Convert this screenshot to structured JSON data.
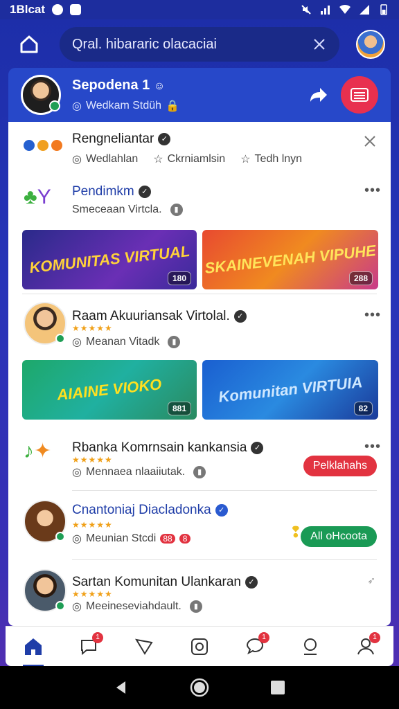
{
  "status_bar": {
    "time": "1Blcat",
    "right_icons": [
      "mute-icon",
      "wifi-icon",
      "signal-icon",
      "battery-icon"
    ]
  },
  "header": {
    "search_text": "Qral. hibararic olacaciai",
    "clear_icon": "close-icon"
  },
  "profile": {
    "name": "Sepodena 1",
    "sub": "Wedkam Stdüh",
    "share_icon": "share-icon",
    "menu_icon": "menu-icon"
  },
  "feed": {
    "item1": {
      "title": "Rengneliantar",
      "actions": [
        "Wedlahlan",
        "Ckrniamlsin",
        "Tedh lnyn"
      ]
    },
    "item2": {
      "title": "Pendimkm",
      "meta": "Smeceaan Virtcla.",
      "banners": [
        {
          "text": "KOMUNITAS VIRTUAL",
          "count": "180"
        },
        {
          "text": "SKAINEVENAH VIPUHE",
          "count": "288"
        }
      ]
    },
    "item3": {
      "title": "Raam Akuuriansak Virtolal.",
      "meta": "Meanan Vitadk",
      "banners": [
        {
          "text": "AIAINE VIOKO",
          "count": "881"
        },
        {
          "text": "Komunitan VIRTUIA",
          "count": "82"
        }
      ]
    },
    "item4": {
      "title": "Rbanka Komrnsain kankansia",
      "meta": "Mennaea nlaaiiutak.",
      "button": "Pelklahahs"
    },
    "item5": {
      "title": "Cnantoniaj Diacladonka",
      "meta": "Meunian Stcdi",
      "meta_badges": [
        "88",
        "8"
      ],
      "button": "All oHcoota"
    },
    "item6": {
      "title": "Sartan Komunitan Ulankaran",
      "meta": "Meeineseviahdault."
    }
  },
  "bottom_nav": [
    {
      "name": "home",
      "icon": "home-icon",
      "badge": ""
    },
    {
      "name": "chat",
      "icon": "chat-icon",
      "badge": "1"
    },
    {
      "name": "explore",
      "icon": "send-icon",
      "badge": ""
    },
    {
      "name": "instagram",
      "icon": "camera-icon",
      "badge": ""
    },
    {
      "name": "messages",
      "icon": "message-icon",
      "badge": "1"
    },
    {
      "name": "community",
      "icon": "community-icon",
      "badge": ""
    },
    {
      "name": "profile",
      "icon": "profile-icon",
      "badge": "1"
    }
  ],
  "colors": {
    "accent": "#1f3da8",
    "header_bg": "#2748c9",
    "danger": "#e23340",
    "success": "#1a9a55"
  }
}
